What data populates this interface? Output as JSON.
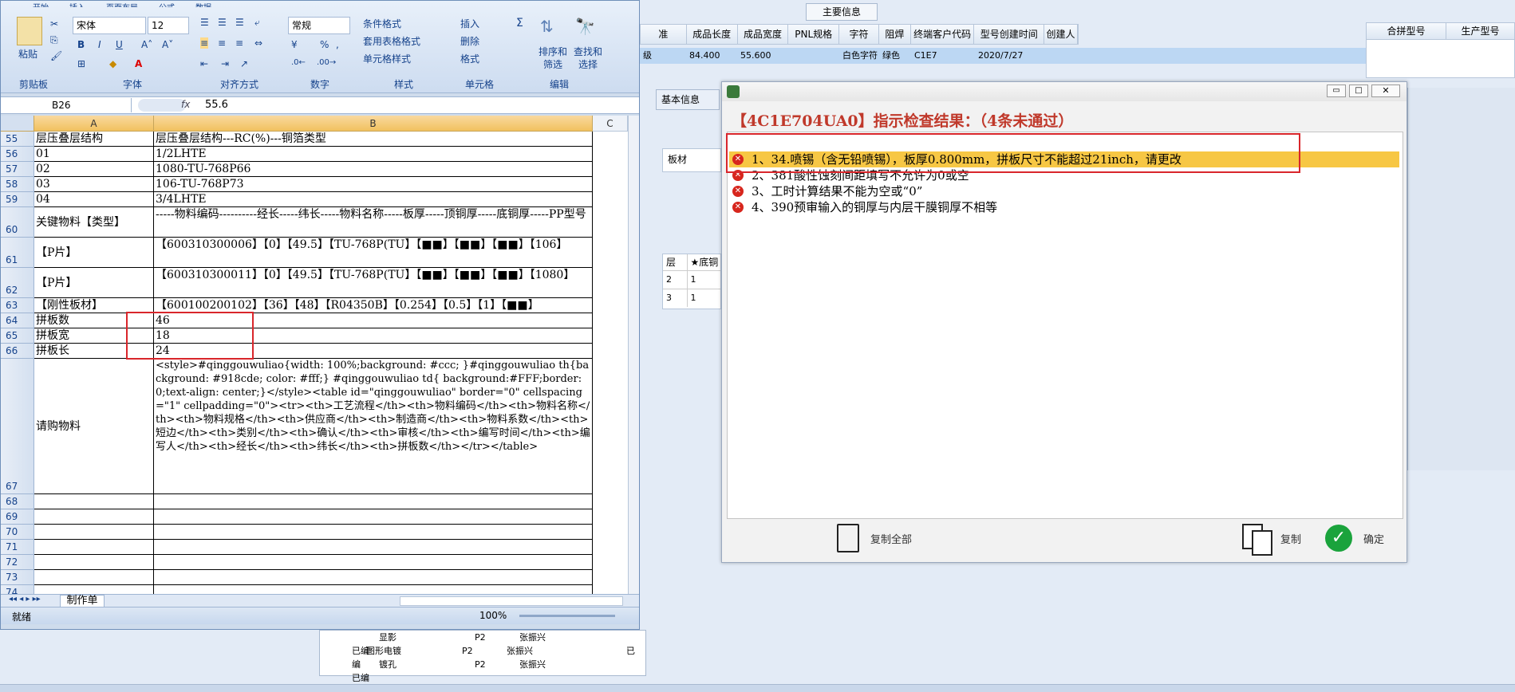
{
  "bg": {
    "section_title": "主要信息",
    "headers": [
      "准",
      "成品长度",
      "成品宽度",
      "PNL规格",
      "字符",
      "阻焊",
      "终端客户代码",
      "型号创建时间",
      "创建人"
    ],
    "row": [
      "级",
      "84.400",
      "55.600",
      "",
      "白色字符",
      "绿色",
      "C1E7",
      "2020/7/27",
      ""
    ],
    "right_headers": [
      "合拼型号",
      "生产型号"
    ],
    "tab_basic": "基本信息",
    "plate_label": "板材",
    "layer_headers": [
      "层",
      "★底铜"
    ],
    "layer_rows": [
      [
        "2",
        "1"
      ],
      [
        "3",
        "1"
      ]
    ],
    "tree": [
      {
        "label": "显影",
        "c1": "P2",
        "c2": "张振兴",
        "c3": "已编"
      },
      {
        "label": "图形电镀",
        "c1": "P2",
        "c2": "张振兴",
        "c3": "已编"
      },
      {
        "label": "镀孔",
        "c1": "P2",
        "c2": "张振兴",
        "c3": "已编"
      }
    ]
  },
  "excel": {
    "tabs": [
      "开始",
      "插入",
      "页面布局",
      "公式",
      "数据"
    ],
    "font_name": "宋体",
    "font_size": "12",
    "number_format": "常规",
    "groups": [
      "剪贴板",
      "字体",
      "对齐方式",
      "数字",
      "样式",
      "单元格",
      "编辑"
    ],
    "paste_label": "粘贴",
    "style_btns": [
      "条件格式",
      "套用表格格式",
      "单元格样式"
    ],
    "cell_btns": [
      "插入",
      "删除",
      "格式"
    ],
    "edit_btns": [
      "排序和筛选",
      "查找和选择"
    ],
    "name_box": "B26",
    "formula": "55.6",
    "col_headers": [
      "A",
      "B",
      "C"
    ],
    "rows": [
      {
        "n": "55",
        "a": "层压叠层结构",
        "b": "层压叠层结构---RC(%)---铜箔类型"
      },
      {
        "n": "56",
        "a": "01",
        "b": "1/2LHTE"
      },
      {
        "n": "57",
        "a": "02",
        "b": "1080-TU-768P66"
      },
      {
        "n": "58",
        "a": "03",
        "b": "106-TU-768P73"
      },
      {
        "n": "59",
        "a": "04",
        "b": "3/4LHTE"
      },
      {
        "n": "60",
        "a": "关键物料【类型】",
        "b": "-----物料编码----------经长-----纬长-----物料名称-----板厚-----顶铜厚-----底铜厚-----PP型号"
      },
      {
        "n": "61",
        "a": "【P片】",
        "b": "【600310300006】【0】【49.5】【TU-768P(TU】【■■】【■■】【■■】【106】"
      },
      {
        "n": "62",
        "a": "【P片】",
        "b": "【600310300011】【0】【49.5】【TU-768P(TU】【■■】【■■】【■■】【1080】"
      },
      {
        "n": "63",
        "a": "【刚性板材】",
        "b": "【600100200102】【36】【48】【R04350B】【0.254】【0.5】【1】【■■】"
      },
      {
        "n": "64",
        "a": "拼板数",
        "b": "46"
      },
      {
        "n": "65",
        "a": "拼板宽",
        "b": "18"
      },
      {
        "n": "66",
        "a": "拼板长",
        "b": "24"
      },
      {
        "n": "67",
        "a": "请购物料",
        "b": "<style>#qinggouwuliao{width: 100%;background: #ccc; }#qinggouwuliao th{background: #918cde; color: #fff;} #qinggouwuliao td{ background:#FFF;border: 0;text-align: center;}</style><table id=\"qinggouwuliao\" border=\"0\" cellspacing=\"1\" cellpadding=\"0\"><tr><th>工艺流程</th><th>物料编码</th><th>物料名称</th><th>物料规格</th><th>供应商</th><th>制造商</th><th>物料系数</th><th>短边</th><th>类别</th><th>确认</th><th>审核</th><th>编写时间</th><th>编写人</th><th>经长</th><th>纬长</th><th>拼板数</th></tr></table>"
      },
      {
        "n": "68",
        "a": "",
        "b": ""
      },
      {
        "n": "69",
        "a": "",
        "b": ""
      },
      {
        "n": "70",
        "a": "",
        "b": ""
      },
      {
        "n": "71",
        "a": "",
        "b": ""
      },
      {
        "n": "72",
        "a": "",
        "b": ""
      },
      {
        "n": "73",
        "a": "",
        "b": ""
      },
      {
        "n": "74",
        "a": "",
        "b": ""
      }
    ],
    "sheet_tab": "制作单",
    "status_text": "就绪",
    "zoom": "100%"
  },
  "dialog": {
    "heading": "【4C1E704UA0】指示检查结果：（4条未通过）",
    "errors": [
      "1、34.喷锡（含无铅喷锡），板厚0.800mm，拼板尺寸不能超过21inch，请更改",
      "2、381酸性蚀刻间距填写不允许为0或空",
      "3、工时计算结果不能为空或“0”",
      "4、390预审输入的铜厚与内层干膜铜厚不相等"
    ],
    "copy_all": "复制全部",
    "copy": "复制",
    "ok": "确定"
  }
}
